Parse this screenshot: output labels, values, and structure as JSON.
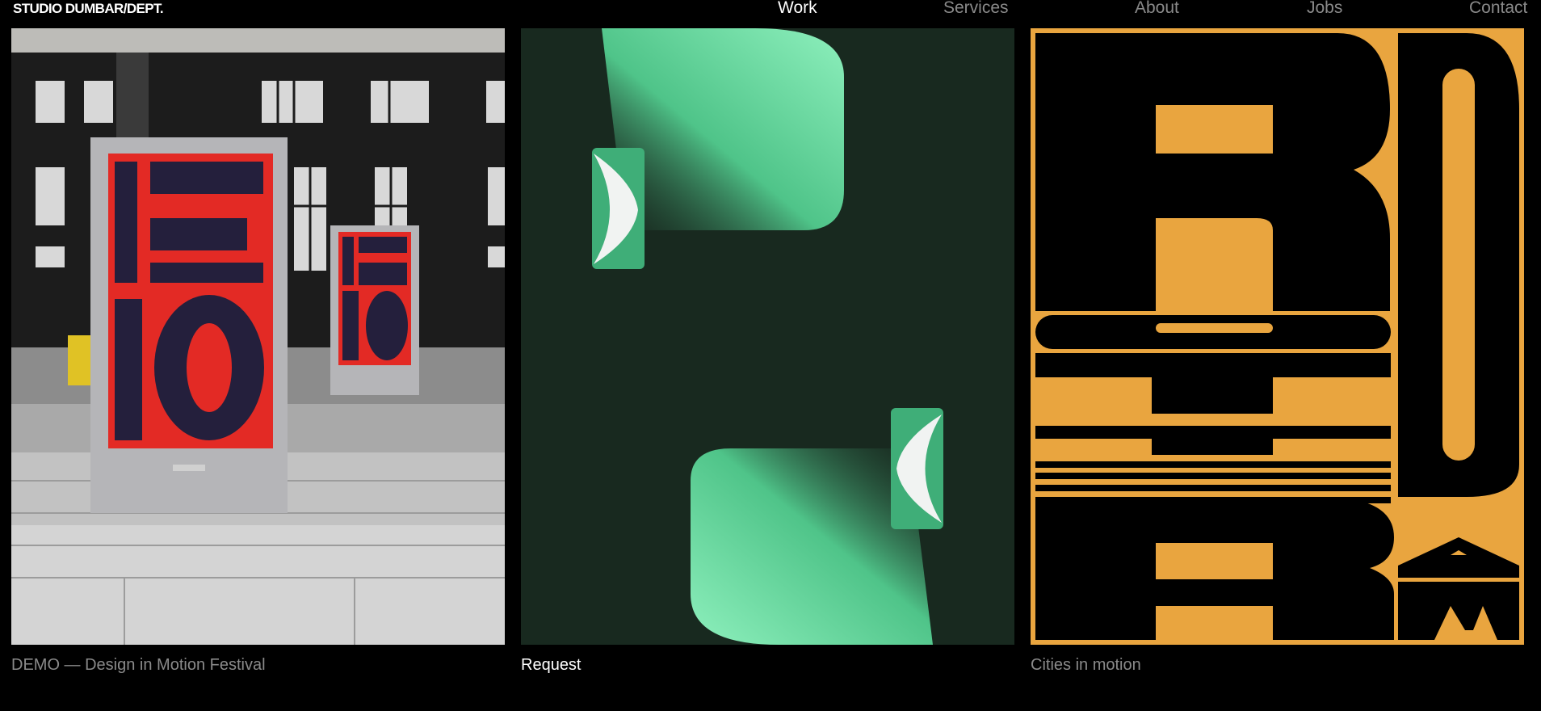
{
  "header": {
    "logo": "STUDIO DUMBAR/DEPT.",
    "nav": [
      {
        "label": "Work",
        "active": true
      },
      {
        "label": "Services",
        "active": false
      },
      {
        "label": "About",
        "active": false
      },
      {
        "label": "Jobs",
        "active": false
      },
      {
        "label": "Contact",
        "active": false
      }
    ]
  },
  "projects": [
    {
      "caption": "DEMO — Design in Motion Festival",
      "poster_text_top": "DE",
      "poster_text_bottom": "MO",
      "accent": "#e32a25",
      "ink": "#241f3c"
    },
    {
      "caption": "Request",
      "background": "#18291f",
      "accent": "#6ee0a4"
    },
    {
      "caption": "Cities in motion",
      "background": "#e9a53f",
      "ink": "#000000",
      "letters": [
        "R",
        "O",
        "T",
        "T",
        "E",
        "R",
        "D",
        "A",
        "M"
      ]
    }
  ]
}
